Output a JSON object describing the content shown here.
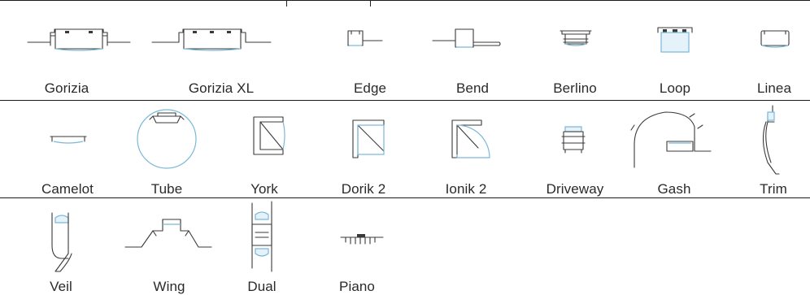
{
  "profiles": [
    {
      "name": "Gorizia"
    },
    {
      "name": "Gorizia XL"
    },
    {
      "name": "Edge"
    },
    {
      "name": "Bend"
    },
    {
      "name": "Berlino"
    },
    {
      "name": "Loop"
    },
    {
      "name": "Linea"
    },
    {
      "name": "Camelot"
    },
    {
      "name": "Tube"
    },
    {
      "name": "York"
    },
    {
      "name": "Dorik 2"
    },
    {
      "name": "Ionik 2"
    },
    {
      "name": "Driveway"
    },
    {
      "name": "Gash"
    },
    {
      "name": "Trim"
    },
    {
      "name": "Veil"
    },
    {
      "name": "Wing"
    },
    {
      "name": "Dual"
    },
    {
      "name": "Piano"
    }
  ],
  "colors": {
    "line": "#3a3a3a",
    "diffuser": "#7ab8d9"
  }
}
